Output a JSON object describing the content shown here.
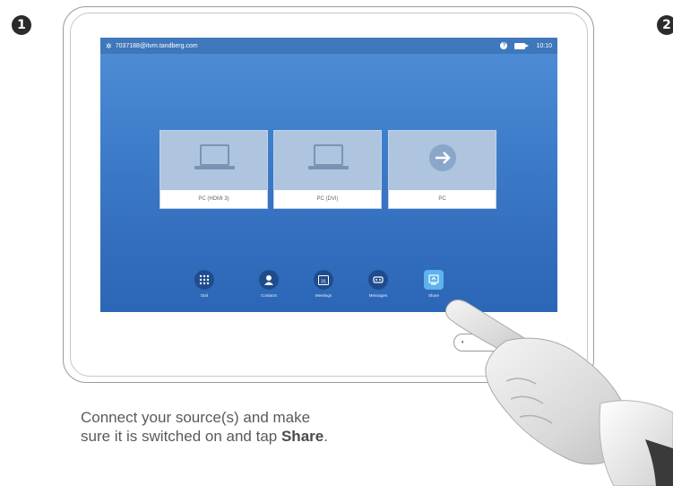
{
  "steps": {
    "first": "❶",
    "second": "2"
  },
  "status_bar": {
    "sip_address": "7037188@itvm.tandberg.com",
    "time": "10:10",
    "icons": [
      "gear-icon",
      "help-icon",
      "camera-icon"
    ]
  },
  "sources": [
    {
      "label": "PC (HDMI 3)",
      "icon": "laptop-icon"
    },
    {
      "label": "PC (DVI)",
      "icon": "laptop-icon"
    },
    {
      "label": "PC",
      "icon": "arrow-right-icon"
    }
  ],
  "dock": {
    "dial": "Dial",
    "contacts": "Contacts",
    "meetings": "Meetings",
    "meetings_date": "31",
    "messages": "Messages",
    "share": "Share"
  },
  "volume": {
    "icon": "speaker-icon"
  },
  "caption": {
    "line1": "Connect your source(s) and make",
    "line2_prefix": "sure it is switched on and tap ",
    "line2_bold": "Share",
    "line2_suffix": "."
  },
  "colors": {
    "screen_blue": "#3f7fcb",
    "tile_blue": "#aec4df",
    "dock_dark": "#1f4c8c",
    "share_highlight": "#5db3ec"
  }
}
